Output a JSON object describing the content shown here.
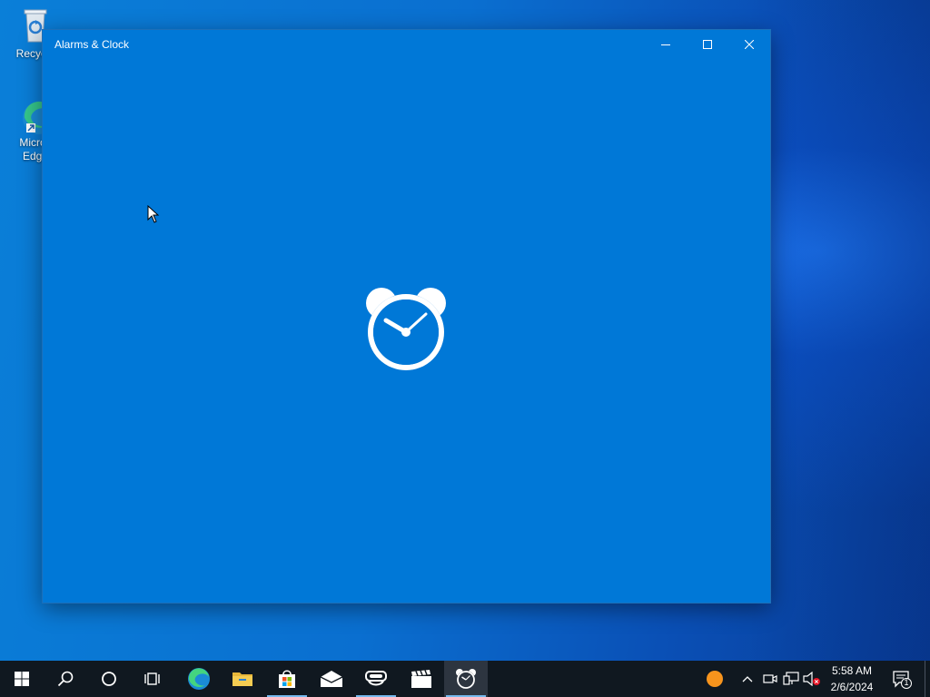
{
  "desktop": {
    "icons": [
      {
        "label": "Recycle Bin",
        "visible_label": "Recycle"
      },
      {
        "label_line1": "Micros",
        "label_line2": "Edge"
      }
    ]
  },
  "window": {
    "title": "Alarms & Clock",
    "minimize_icon": "minimize-icon",
    "maximize_icon": "maximize-icon",
    "close_icon": "close-icon",
    "splash_icon": "alarm-clock-icon",
    "background": "#0078d7"
  },
  "taskbar": {
    "apps": [
      {
        "name": "start",
        "icon": "windows-logo-icon"
      },
      {
        "name": "search",
        "icon": "search-icon"
      },
      {
        "name": "cortana",
        "icon": "circle-icon"
      },
      {
        "name": "task-view",
        "icon": "task-view-icon"
      },
      {
        "name": "edge",
        "icon": "edge-icon"
      },
      {
        "name": "file-explorer",
        "icon": "folder-icon"
      },
      {
        "name": "store",
        "icon": "store-bag-icon"
      },
      {
        "name": "mail",
        "icon": "mail-icon"
      },
      {
        "name": "mixed-reality",
        "icon": "headset-icon"
      },
      {
        "name": "movies-tv",
        "icon": "clapperboard-icon"
      },
      {
        "name": "alarms-clock",
        "icon": "alarm-clock-icon"
      }
    ],
    "tray": {
      "time": "5:58 AM",
      "date": "2/6/2024",
      "notification_count": "1"
    },
    "background": "#101820"
  }
}
